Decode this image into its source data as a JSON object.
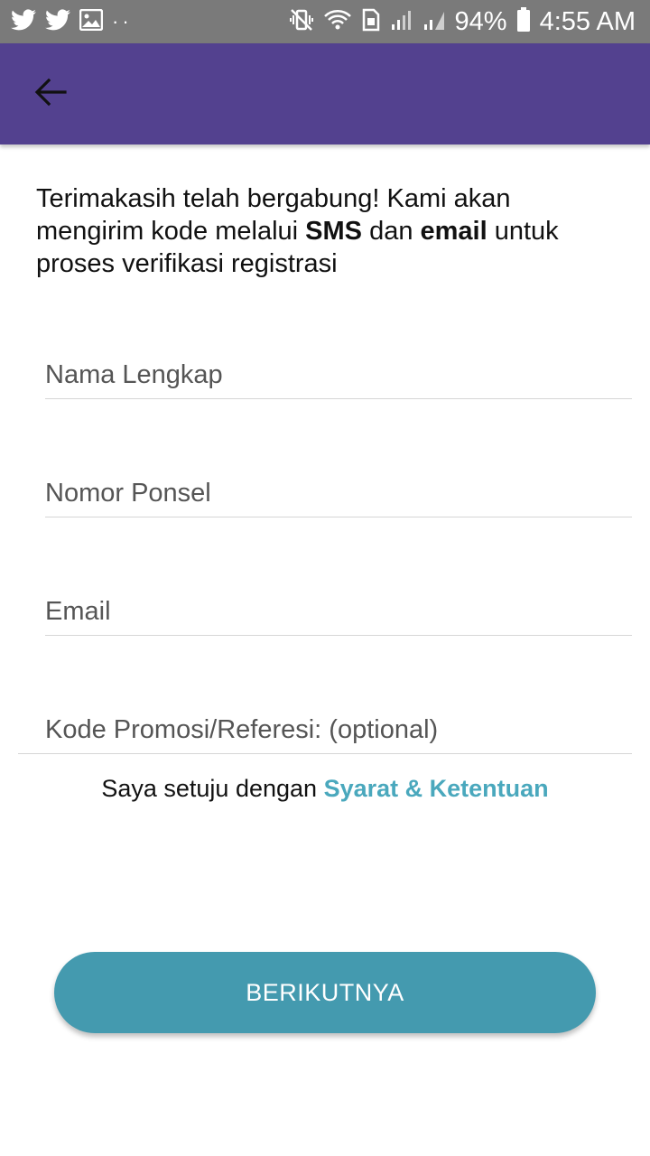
{
  "status_bar": {
    "battery": "94%",
    "time": "4:55 AM",
    "left_icons": [
      "twitter-icon",
      "twitter-icon",
      "image-icon",
      "more-dots-icon"
    ],
    "right_icons": [
      "vibrate-mute-icon",
      "wifi-icon",
      "sim-icon",
      "signal-icon",
      "signal-icon",
      "battery-icon"
    ],
    "dots": "··"
  },
  "app_bar": {
    "back_icon": "arrow-back-icon",
    "background": "#53418f"
  },
  "intro": {
    "part1": "Terimakasih telah bergabung! Kami akan mengirim kode melalui ",
    "sms": "SMS",
    "part2": " dan ",
    "email": "email",
    "part3": " untuk proses verifikasi registrasi"
  },
  "form": {
    "full_name_placeholder": "Nama Lengkap",
    "phone_placeholder": "Nomor Ponsel",
    "email_placeholder": "Email",
    "promo_placeholder": "Kode Promosi/Referesi: (optional)"
  },
  "terms": {
    "text": "Saya setuju dengan ",
    "link": "Syarat & Ketentuan",
    "link_color": "#4aa8bd"
  },
  "next_button": {
    "label": "BERIKUTNYA",
    "color": "#449aaf"
  }
}
